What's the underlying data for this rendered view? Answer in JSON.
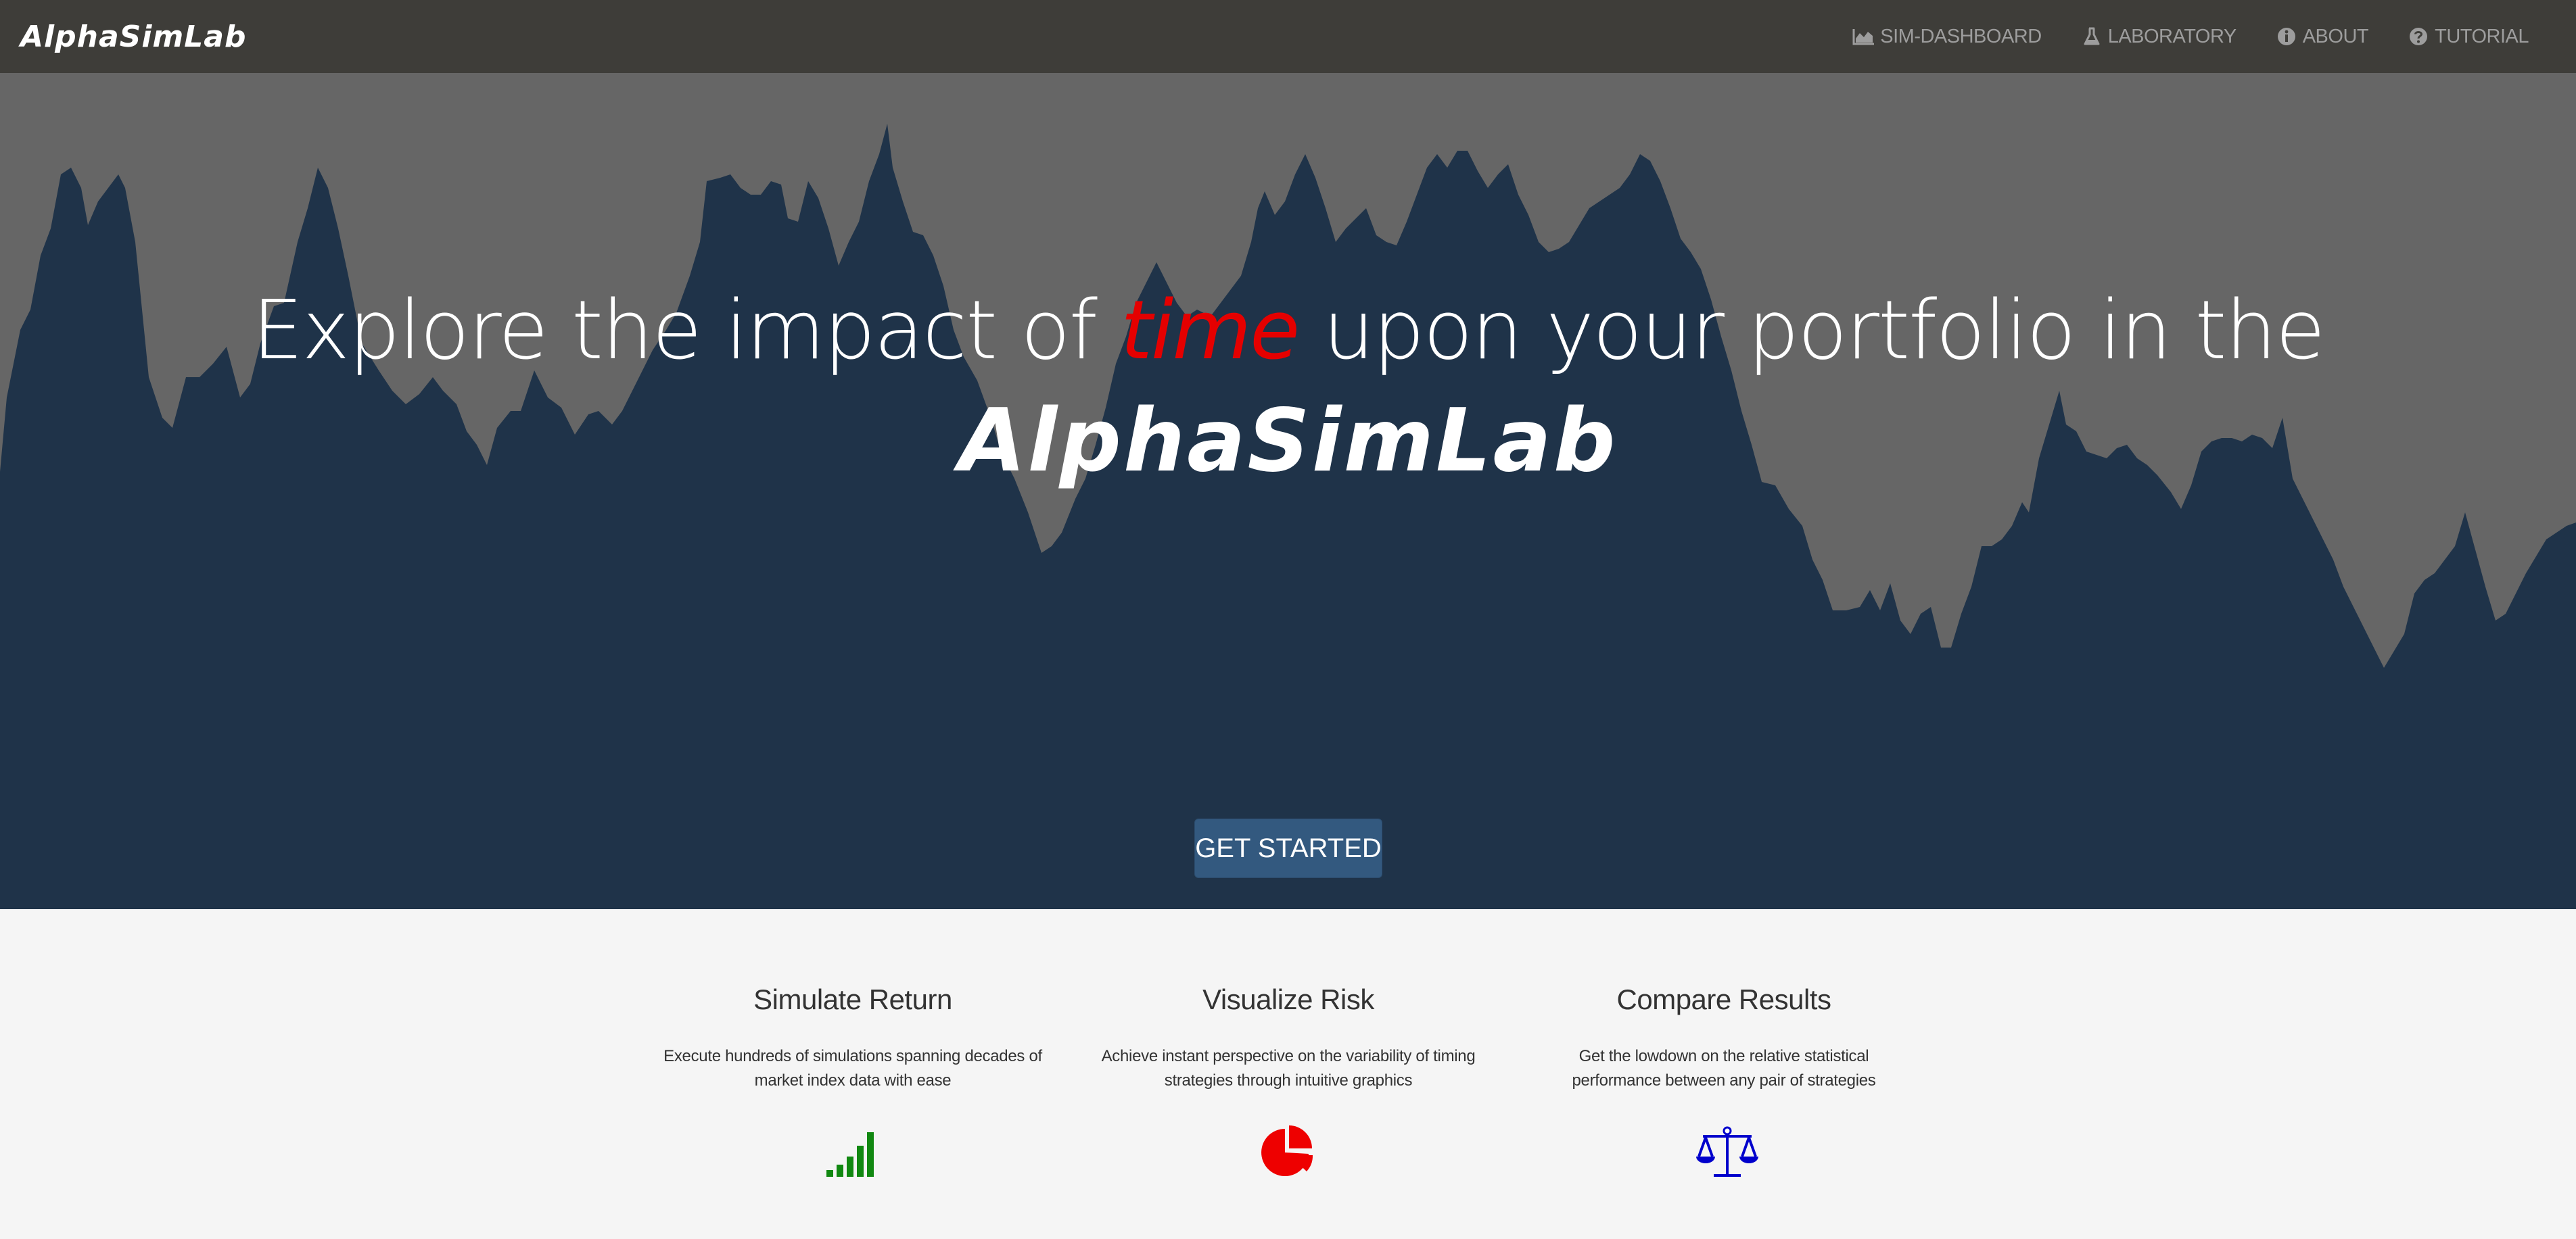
{
  "brand": "AlphaSimLab",
  "nav": [
    {
      "label": "SIM-DASHBOARD",
      "icon": "area-chart-icon"
    },
    {
      "label": "LABORATORY",
      "icon": "flask-icon"
    },
    {
      "label": "ABOUT",
      "icon": "info-circle-icon"
    },
    {
      "label": "TUTORIAL",
      "icon": "question-circle-icon"
    }
  ],
  "hero": {
    "title_before": "Explore the impact of ",
    "title_highlight": "time",
    "title_after": " upon your portfolio in the",
    "logo": "AlphaSimLab",
    "cta": "GET STARTED"
  },
  "features": [
    {
      "title": "Simulate Return",
      "desc": "Execute hundreds of simulations spanning decades of market index data with ease",
      "icon": "signal-bars-icon"
    },
    {
      "title": "Visualize Risk",
      "desc": "Achieve instant perspective on the variability of timing strategies through intuitive graphics",
      "icon": "pie-chart-icon"
    },
    {
      "title": "Compare Results",
      "desc": "Get the lowdown on the relative statistical performance between any pair of strategies",
      "icon": "balance-scale-icon"
    }
  ],
  "colors": {
    "navbar": "#3e3d39",
    "hero_bg": "#666666",
    "area_fill": "#1f3349",
    "accent_red": "#e50000",
    "cta": "#33597f",
    "icon_green": "#118811",
    "icon_red": "#ee0000",
    "icon_blue": "#0000cc"
  }
}
